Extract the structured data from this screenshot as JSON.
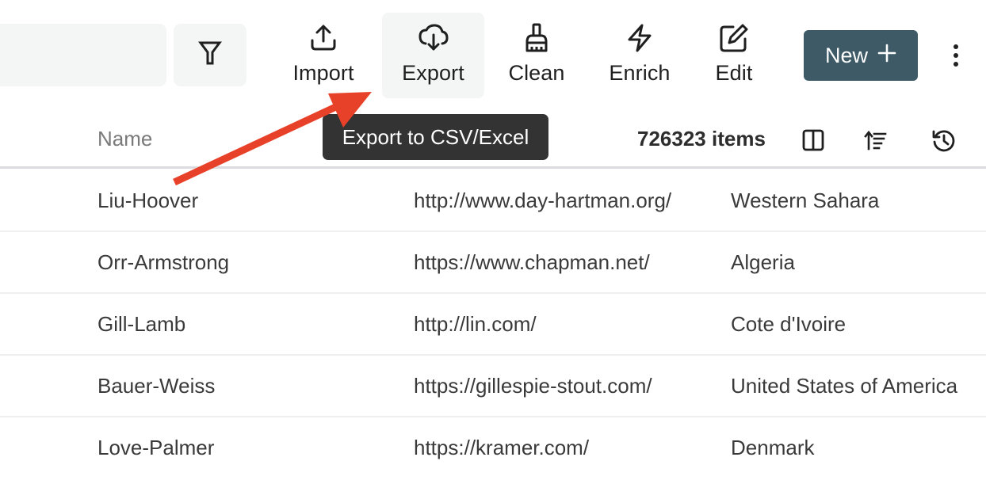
{
  "toolbar": {
    "search": {
      "value": "",
      "placeholder": ""
    },
    "filter_icon": "filter-icon",
    "actions": [
      {
        "id": "import",
        "label": "Import",
        "icon": "upload-icon"
      },
      {
        "id": "export",
        "label": "Export",
        "icon": "cloud-download-icon",
        "active": true
      },
      {
        "id": "clean",
        "label": "Clean",
        "icon": "broom-icon"
      },
      {
        "id": "enrich",
        "label": "Enrich",
        "icon": "lightning-icon"
      },
      {
        "id": "edit",
        "label": "Edit",
        "icon": "edit-icon"
      }
    ],
    "new_button": {
      "label": "New",
      "icon": "plus-icon"
    },
    "more_icon": "more-vertical-icon"
  },
  "tooltip": {
    "text": "Export to CSV/Excel"
  },
  "table": {
    "header": {
      "name_column": "Name",
      "items_count": "726323 items",
      "icons": [
        "columns-icon",
        "sort-icon",
        "history-icon"
      ]
    },
    "rows": [
      {
        "name": "Liu-Hoover",
        "url": "http://www.day-hartman.org/",
        "country": "Western Sahara"
      },
      {
        "name": "Orr-Armstrong",
        "url": "https://www.chapman.net/",
        "country": "Algeria"
      },
      {
        "name": "Gill-Lamb",
        "url": "http://lin.com/",
        "country": "Cote d'Ivoire"
      },
      {
        "name": "Bauer-Weiss",
        "url": "https://gillespie-stout.com/",
        "country": "United States of America"
      },
      {
        "name": "Love-Palmer",
        "url": "https://kramer.com/",
        "country": "Denmark"
      }
    ]
  },
  "colors": {
    "primary": "#3d5a66",
    "tooltip_bg": "#333333",
    "annotation_arrow": "#e8412a",
    "button_bg": "#f4f5f5"
  }
}
